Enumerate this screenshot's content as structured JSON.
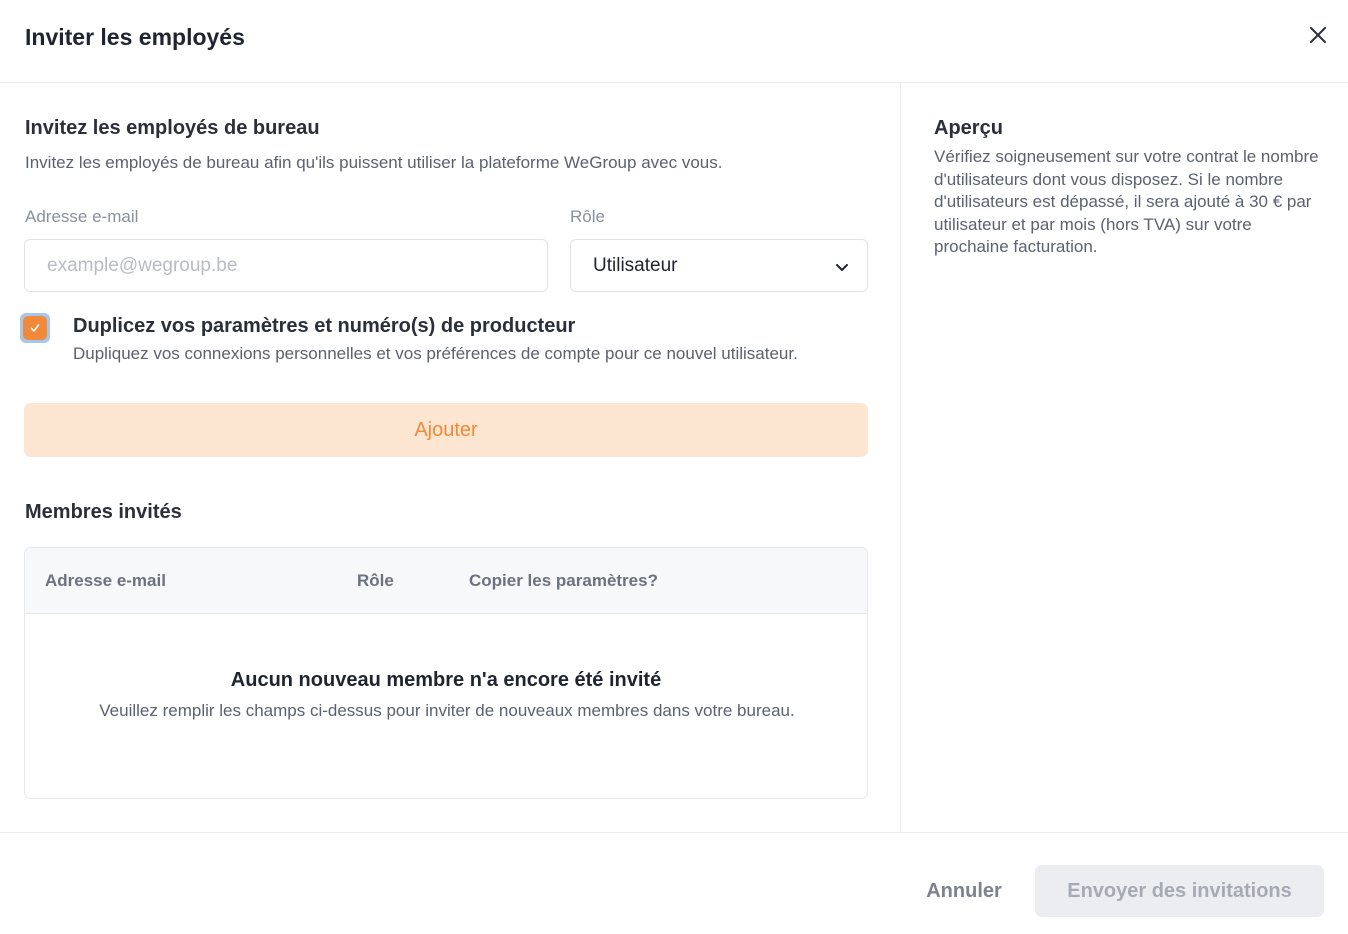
{
  "modal": {
    "title": "Inviter les employés",
    "close_icon": "close-icon"
  },
  "invite": {
    "title": "Invitez les employés de bureau",
    "description": "Invitez les employés de bureau afin qu'ils puissent utiliser la plateforme WeGroup avec vous.",
    "email_label": "Adresse e-mail",
    "email_placeholder": "example@wegroup.be",
    "email_value": "",
    "role_label": "Rôle",
    "role_value": "Utilisateur",
    "role_icon": "chevron-down-icon",
    "duplicate_checked": true,
    "duplicate_title": "Duplicez vos paramètres et numéro(s) de producteur",
    "duplicate_desc": "Dupliquez vos connexions personnelles et vos préférences de compte pour ce nouvel utilisateur.",
    "add_button": "Ajouter"
  },
  "members": {
    "title": "Membres invités",
    "columns": [
      "Adresse e-mail",
      "Rôle",
      "Copier les paramètres?"
    ],
    "rows": [],
    "empty_title": "Aucun nouveau membre n'a encore été invité",
    "empty_desc": "Veuillez remplir les champs ci-dessus pour inviter de nouveaux membres dans votre bureau."
  },
  "overview": {
    "title": "Aperçu",
    "text": "Vérifiez soigneusement sur votre contrat le nombre d'utilisateurs dont vous disposez. Si le nombre d'utilisateurs est dépassé, il sera ajouté à 30 € par utilisateur et par mois (hors TVA) sur votre prochaine facturation."
  },
  "footer": {
    "cancel": "Annuler",
    "send": "Envoyer des invitations"
  },
  "colors": {
    "accent": "#f08a38",
    "accent_light": "#fde6d1",
    "focus_ring": "#a8c6ea",
    "disabled_bg": "#ecedf0"
  }
}
